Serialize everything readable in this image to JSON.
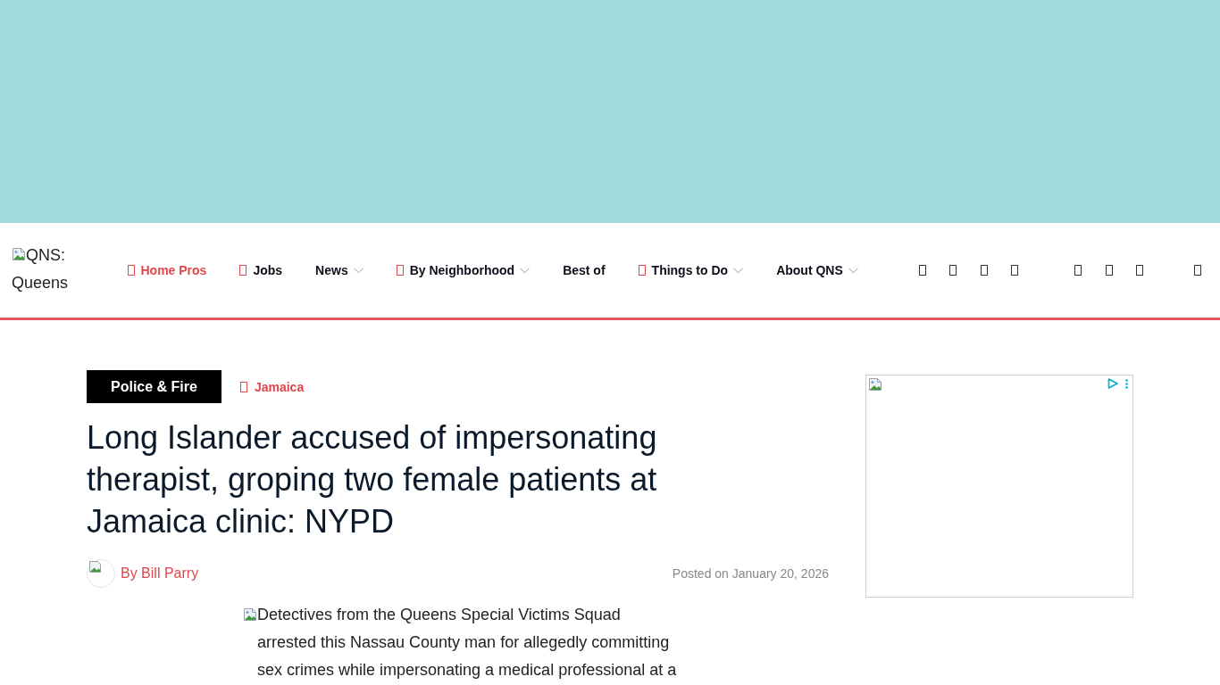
{
  "header": {
    "logo": {
      "alt_text": "QNS: Queens"
    },
    "nav": [
      {
        "label": "Home Pros",
        "has_icon": true,
        "highlighted": true,
        "dropdown": false
      },
      {
        "label": "Jobs",
        "has_icon": true,
        "highlighted": false,
        "dropdown": false
      },
      {
        "label": "News",
        "has_icon": false,
        "highlighted": false,
        "dropdown": true
      },
      {
        "label": "By Neighborhood",
        "has_icon": true,
        "highlighted": false,
        "dropdown": true
      },
      {
        "label": "Best of",
        "has_icon": false,
        "highlighted": false,
        "dropdown": false
      },
      {
        "label": "Things to Do",
        "has_icon": true,
        "highlighted": false,
        "dropdown": true
      },
      {
        "label": "About QNS",
        "has_icon": false,
        "highlighted": false,
        "dropdown": true
      }
    ]
  },
  "article": {
    "category": "Police & Fire",
    "tag": "Jamaica",
    "title": "Long Islander accused of impersonating therapist, groping two female patients at Jamaica clinic: NYPD",
    "author": "By Bill Parry",
    "posted": "Posted on January 20, 2026",
    "image_alt_text": "Detectives from the Queens Special Victims Squad arrested this Nassau County man for allegedly committing sex crimes while impersonating a medical professional at a"
  }
}
